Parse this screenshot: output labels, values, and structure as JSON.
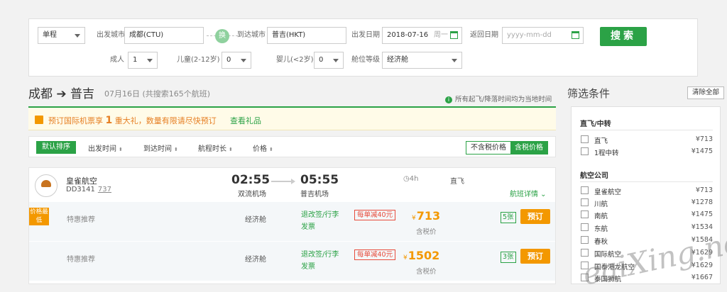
{
  "search": {
    "trip_type": "单程",
    "from_label": "出发城市",
    "from_value": "成都(CTU)",
    "swap_label": "换",
    "to_label": "到达城市",
    "to_value": "普吉(HKT)",
    "depart_label": "出发日期",
    "depart_value": "2018-07-16",
    "depart_weekday": "周一",
    "return_label": "返回日期",
    "return_placeholder": "yyyy-mm-dd",
    "search_button": "搜索",
    "adult_label": "成人",
    "adult_value": "1",
    "child_label": "儿童(2-12岁)",
    "child_value": "0",
    "infant_label": "婴儿(<2岁)",
    "infant_value": "0",
    "cabin_label": "舱位等级",
    "cabin_value": "经济舱"
  },
  "route": {
    "title": "成都 ➔ 普吉",
    "subtitle": "07月16日 (共搜索165个航班)",
    "timezone_note": "所有起飞/降落时间均为当地时间",
    "timezone_icon": "i"
  },
  "promo": {
    "text_before": "预订国际机票享 ",
    "highlight": "1",
    "text_after": " 重大礼，数量有限请尽快预订",
    "link": "查看礼品"
  },
  "sortbar": {
    "default": "默认排序",
    "items": [
      "出发时间",
      "到达时间",
      "航程时长",
      "价格"
    ],
    "arrow": "⬍",
    "toggle_off": "不含税价格",
    "toggle_on": "含税价格"
  },
  "flight": {
    "airline": "皇雀航空",
    "flight_no": "DD3141",
    "aircraft": "737",
    "dep_time": "02:55",
    "dep_airport": "双流机场",
    "arr_time": "05:55",
    "arr_airport": "普吉机场",
    "duration": "4h",
    "stops": "直飞",
    "details": "航班详情 ⌄",
    "fares": [
      {
        "badge": "价格最低",
        "name": "特惠推荐",
        "cabin": "经济舱",
        "rules_line1": "退改签/行李",
        "rules_line2": "发票",
        "coupon": "每单减40元",
        "currency": "¥",
        "price": "713",
        "tax_note": "含税价",
        "seats": "5张",
        "book": "预订"
      },
      {
        "badge": "",
        "name": "特惠推荐",
        "cabin": "经济舱",
        "rules_line1": "退改签/行李",
        "rules_line2": "发票",
        "coupon": "每单减40元",
        "currency": "¥",
        "price": "1502",
        "tax_note": "含税价",
        "seats": "3张",
        "book": "预订"
      }
    ]
  },
  "filter": {
    "title": "筛选条件",
    "clear": "清除全部",
    "groups": [
      {
        "title": "直飞/中转",
        "items": [
          {
            "label": "直飞",
            "price": "¥713"
          },
          {
            "label": "1程中转",
            "price": "¥1475"
          }
        ]
      },
      {
        "title": "航空公司",
        "items": [
          {
            "label": "皇雀航空",
            "price": "¥713"
          },
          {
            "label": "川航",
            "price": "¥1278"
          },
          {
            "label": "南航",
            "price": "¥1475"
          },
          {
            "label": "东航",
            "price": "¥1534"
          },
          {
            "label": "春秋",
            "price": "¥1584"
          },
          {
            "label": "国际航空",
            "price": "¥1629"
          },
          {
            "label": "国泰港龙航空",
            "price": "¥1629"
          },
          {
            "label": "泰国狮航",
            "price": "¥1667"
          }
        ]
      }
    ]
  },
  "watermark": "eaiXing.net",
  "colors": {
    "accent": "#2ba246",
    "orange": "#f39800",
    "coupon": "#e74c3c"
  }
}
